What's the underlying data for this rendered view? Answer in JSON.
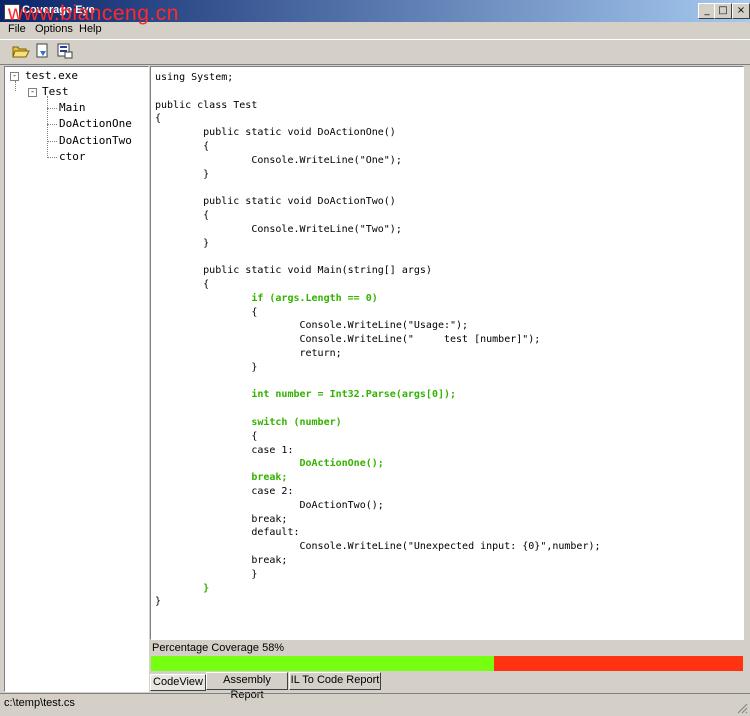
{
  "window": {
    "title": "Coverage Eye",
    "watermark": "www.bianceng.cn"
  },
  "menu": {
    "file": "File",
    "options": "Options",
    "help": "Help"
  },
  "tree": {
    "root": "test.exe",
    "class": "Test",
    "methods": [
      "Main",
      "DoActionOne",
      "DoActionTwo",
      "ctor"
    ]
  },
  "code": [
    {
      "text": "using System;",
      "covered": false
    },
    {
      "text": "",
      "covered": false
    },
    {
      "text": "public class Test",
      "covered": false
    },
    {
      "text": "{",
      "covered": false
    },
    {
      "text": "        public static void DoActionOne()",
      "covered": false
    },
    {
      "text": "        {",
      "covered": false
    },
    {
      "text": "                Console.WriteLine(\"One\");",
      "covered": false
    },
    {
      "text": "        }",
      "covered": false
    },
    {
      "text": "",
      "covered": false
    },
    {
      "text": "        public static void DoActionTwo()",
      "covered": false
    },
    {
      "text": "        {",
      "covered": false
    },
    {
      "text": "                Console.WriteLine(\"Two\");",
      "covered": false
    },
    {
      "text": "        }",
      "covered": false
    },
    {
      "text": "",
      "covered": false
    },
    {
      "text": "        public static void Main(string[] args)",
      "covered": false
    },
    {
      "text": "        {",
      "covered": false
    },
    {
      "text": "                if (args.Length == 0)",
      "covered": true
    },
    {
      "text": "                {",
      "covered": false
    },
    {
      "text": "                        Console.WriteLine(\"Usage:\");",
      "covered": false
    },
    {
      "text": "                        Console.WriteLine(\"     test [number]\");",
      "covered": false
    },
    {
      "text": "                        return;",
      "covered": false
    },
    {
      "text": "                }",
      "covered": false
    },
    {
      "text": "",
      "covered": false
    },
    {
      "text": "                int number = Int32.Parse(args[0]);",
      "covered": true
    },
    {
      "text": "",
      "covered": false
    },
    {
      "text": "                switch (number)",
      "covered": true
    },
    {
      "text": "                {",
      "covered": false
    },
    {
      "text": "                case 1:",
      "covered": false
    },
    {
      "text": "                        DoActionOne();",
      "covered": true
    },
    {
      "text": "                break;",
      "covered": true
    },
    {
      "text": "                case 2:",
      "covered": false
    },
    {
      "text": "                        DoActionTwo();",
      "covered": false
    },
    {
      "text": "                break;",
      "covered": false
    },
    {
      "text": "                default:",
      "covered": false
    },
    {
      "text": "                        Console.WriteLine(\"Unexpected input: {0}\",number);",
      "covered": false
    },
    {
      "text": "                break;",
      "covered": false
    },
    {
      "text": "                }",
      "covered": false
    },
    {
      "text": "        }",
      "covered": true
    },
    {
      "text": "}",
      "covered": false
    }
  ],
  "coverage": {
    "label": "Percentage Coverage 58%",
    "percent": 58,
    "covered_color": "#77ff11",
    "uncovered_color": "#ff3311"
  },
  "tabs": [
    "CodeView",
    "Assembly Report",
    "IL To Code Report"
  ],
  "status": {
    "path": "c:\\temp\\test.cs"
  },
  "icons": [
    "open-folder-icon",
    "open-file-icon",
    "report-icon"
  ]
}
